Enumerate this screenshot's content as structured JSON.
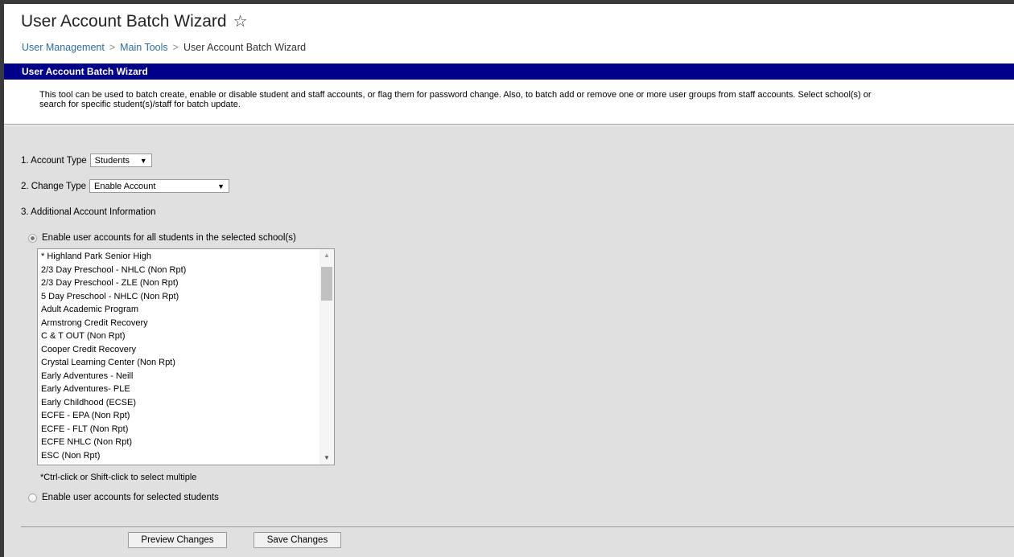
{
  "page": {
    "title": "User Account Batch Wizard",
    "star_icon": "☆"
  },
  "breadcrumb": {
    "items": [
      "User Management",
      "Main Tools"
    ],
    "separator": ">",
    "current": "User Account Batch Wizard"
  },
  "panel": {
    "header": "User Account Batch Wizard",
    "description_line1": "This tool can be used to batch create, enable or disable student and staff accounts, or flag them for password change. Also, to batch add or remove one or more user groups from staff accounts. Select school(s) or",
    "description_line2": "search for specific student(s)/staff for batch update."
  },
  "form": {
    "account_type": {
      "label": "1. Account Type",
      "value": "Students"
    },
    "change_type": {
      "label": "2. Change Type",
      "value": "Enable Account"
    },
    "additional_info_label": "3. Additional Account Information",
    "radio_all": {
      "label": "Enable user accounts for all students in the selected school(s)",
      "checked": true
    },
    "radio_selected": {
      "label": "Enable user accounts for selected students",
      "checked": false
    },
    "schools": [
      "* Highland Park Senior High",
      "2/3 Day Preschool - NHLC (Non Rpt)",
      "2/3 Day Preschool - ZLE (Non Rpt)",
      "5 Day Preschool - NHLC (Non Rpt)",
      "Adult Academic Program",
      "Armstrong Credit Recovery",
      "C & T OUT (Non Rpt)",
      "Cooper Credit Recovery",
      "Crystal Learning Center (Non Rpt)",
      "Early Adventures - Neill",
      "Early Adventures- PLE",
      "Early Childhood (ECSE)",
      "ECFE - EPA (Non Rpt)",
      "ECFE - FLT (Non Rpt)",
      "ECFE NHLC (Non Rpt)",
      "ESC (Non Rpt)"
    ],
    "multi_select_hint": "*Ctrl-click or Shift-click to select multiple"
  },
  "buttons": {
    "preview": "Preview Changes",
    "save": "Save Changes"
  },
  "colors": {
    "header_bg": "#00008b",
    "content_bg": "#e0e0e0",
    "link": "#2e6da4"
  }
}
